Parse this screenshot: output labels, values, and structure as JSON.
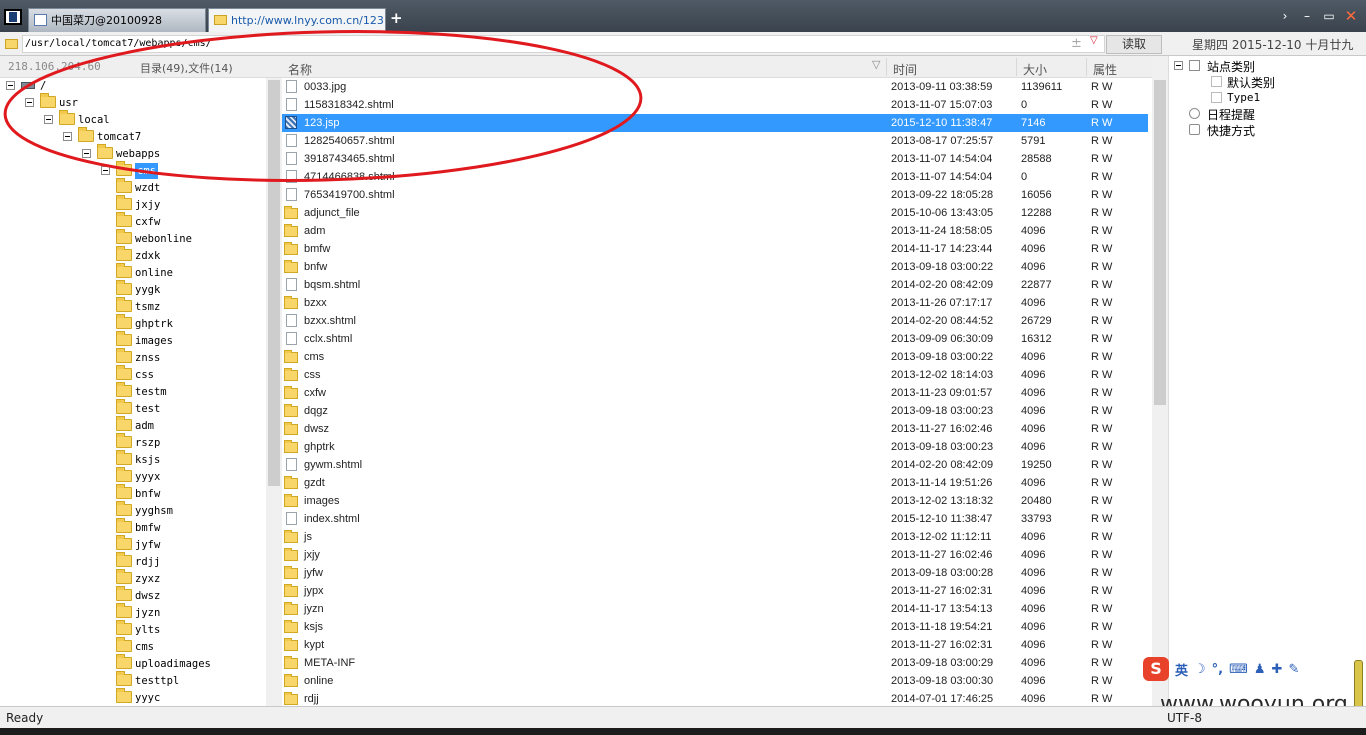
{
  "tabs": [
    {
      "label": "中国菜刀@20100928",
      "icon": "page-icon"
    },
    {
      "label": "http://www.lnyy.com.cn/123.j...",
      "icon": "folder-icon"
    }
  ],
  "tab_add_label": "+",
  "window_controls": {
    "more": "›",
    "minimize": "–",
    "maximize": "▭",
    "close": "✕"
  },
  "address": {
    "path": "/usr/local/tomcat7/webapps/cms/",
    "read_label": "读取",
    "add_glyph": "±",
    "dropdown_glyph": "▽",
    "date": "星期四 2015-12-10 十月廿九"
  },
  "left_panel": {
    "ip": "218.106.204.60",
    "count": "目录(49),文件(14)"
  },
  "tree": [
    {
      "label": "/",
      "icon": "drive-icon"
    },
    {
      "label": "usr",
      "icon": "folder-icon"
    },
    {
      "label": "local",
      "icon": "folder-icon"
    },
    {
      "label": "tomcat7",
      "icon": "folder-icon"
    },
    {
      "label": "webapps",
      "icon": "folder-icon"
    },
    {
      "label": "cms",
      "icon": "folder-icon",
      "selected": true
    },
    {
      "label": "wzdt",
      "icon": "folder-icon"
    },
    {
      "label": "jxjy",
      "icon": "folder-icon"
    },
    {
      "label": "cxfw",
      "icon": "folder-icon"
    },
    {
      "label": "webonline",
      "icon": "folder-icon"
    },
    {
      "label": "zdxk",
      "icon": "folder-icon"
    },
    {
      "label": "online",
      "icon": "folder-icon"
    },
    {
      "label": "yygk",
      "icon": "folder-icon"
    },
    {
      "label": "tsmz",
      "icon": "folder-icon"
    },
    {
      "label": "ghptrk",
      "icon": "folder-icon"
    },
    {
      "label": "images",
      "icon": "folder-icon"
    },
    {
      "label": "znss",
      "icon": "folder-icon"
    },
    {
      "label": "css",
      "icon": "folder-icon"
    },
    {
      "label": "testm",
      "icon": "folder-icon"
    },
    {
      "label": "test",
      "icon": "folder-icon"
    },
    {
      "label": "adm",
      "icon": "folder-icon"
    },
    {
      "label": "rszp",
      "icon": "folder-icon"
    },
    {
      "label": "ksjs",
      "icon": "folder-icon"
    },
    {
      "label": "yyyx",
      "icon": "folder-icon"
    },
    {
      "label": "bnfw",
      "icon": "folder-icon"
    },
    {
      "label": "yyghsm",
      "icon": "folder-icon"
    },
    {
      "label": "bmfw",
      "icon": "folder-icon"
    },
    {
      "label": "jyfw",
      "icon": "folder-icon"
    },
    {
      "label": "rdjj",
      "icon": "folder-icon"
    },
    {
      "label": "zyxz",
      "icon": "folder-icon"
    },
    {
      "label": "dwsz",
      "icon": "folder-icon"
    },
    {
      "label": "jyzn",
      "icon": "folder-icon"
    },
    {
      "label": "ylts",
      "icon": "folder-icon"
    },
    {
      "label": "cms",
      "icon": "folder-icon"
    },
    {
      "label": "uploadimages",
      "icon": "folder-icon"
    },
    {
      "label": "testtpl",
      "icon": "folder-icon"
    },
    {
      "label": "yyyc",
      "icon": "folder-icon"
    }
  ],
  "columns": {
    "name": "名称",
    "time": "时间",
    "size": "大小",
    "attr": "属性"
  },
  "files": [
    {
      "name": "0033.jpg",
      "time": "2013-09-11 03:38:59",
      "size": "1139611",
      "attr": "R W",
      "type": "file"
    },
    {
      "name": "1158318342.shtml",
      "time": "2013-11-07 15:07:03",
      "size": "0",
      "attr": "R W",
      "type": "file"
    },
    {
      "name": "123.jsp",
      "time": "2015-12-10 11:38:47",
      "size": "7146",
      "attr": "R W",
      "type": "jsp",
      "selected": true
    },
    {
      "name": "1282540657.shtml",
      "time": "2013-08-17 07:25:57",
      "size": "5791",
      "attr": "R W",
      "type": "file"
    },
    {
      "name": "3918743465.shtml",
      "time": "2013-11-07 14:54:04",
      "size": "28588",
      "attr": "R W",
      "type": "file"
    },
    {
      "name": "4714466838.shtml",
      "time": "2013-11-07 14:54:04",
      "size": "0",
      "attr": "R W",
      "type": "file"
    },
    {
      "name": "7653419700.shtml",
      "time": "2013-09-22 18:05:28",
      "size": "16056",
      "attr": "R W",
      "type": "file"
    },
    {
      "name": "adjunct_file",
      "time": "2015-10-06 13:43:05",
      "size": "12288",
      "attr": "R W",
      "type": "folder"
    },
    {
      "name": "adm",
      "time": "2013-11-24 18:58:05",
      "size": "4096",
      "attr": "R W",
      "type": "folder"
    },
    {
      "name": "bmfw",
      "time": "2014-11-17 14:23:44",
      "size": "4096",
      "attr": "R W",
      "type": "folder"
    },
    {
      "name": "bnfw",
      "time": "2013-09-18 03:00:22",
      "size": "4096",
      "attr": "R W",
      "type": "folder"
    },
    {
      "name": "bqsm.shtml",
      "time": "2014-02-20 08:42:09",
      "size": "22877",
      "attr": "R W",
      "type": "file"
    },
    {
      "name": "bzxx",
      "time": "2013-11-26 07:17:17",
      "size": "4096",
      "attr": "R W",
      "type": "folder"
    },
    {
      "name": "bzxx.shtml",
      "time": "2014-02-20 08:44:52",
      "size": "26729",
      "attr": "R W",
      "type": "file"
    },
    {
      "name": "cclx.shtml",
      "time": "2013-09-09 06:30:09",
      "size": "16312",
      "attr": "R W",
      "type": "file"
    },
    {
      "name": "cms",
      "time": "2013-09-18 03:00:22",
      "size": "4096",
      "attr": "R W",
      "type": "folder"
    },
    {
      "name": "css",
      "time": "2013-12-02 18:14:03",
      "size": "4096",
      "attr": "R W",
      "type": "folder"
    },
    {
      "name": "cxfw",
      "time": "2013-11-23 09:01:57",
      "size": "4096",
      "attr": "R W",
      "type": "folder"
    },
    {
      "name": "dqgz",
      "time": "2013-09-18 03:00:23",
      "size": "4096",
      "attr": "R W",
      "type": "folder"
    },
    {
      "name": "dwsz",
      "time": "2013-11-27 16:02:46",
      "size": "4096",
      "attr": "R W",
      "type": "folder"
    },
    {
      "name": "ghptrk",
      "time": "2013-09-18 03:00:23",
      "size": "4096",
      "attr": "R W",
      "type": "folder"
    },
    {
      "name": "gywm.shtml",
      "time": "2014-02-20 08:42:09",
      "size": "19250",
      "attr": "R W",
      "type": "file"
    },
    {
      "name": "gzdt",
      "time": "2013-11-14 19:51:26",
      "size": "4096",
      "attr": "R W",
      "type": "folder"
    },
    {
      "name": "images",
      "time": "2013-12-02 13:18:32",
      "size": "20480",
      "attr": "R W",
      "type": "folder"
    },
    {
      "name": "index.shtml",
      "time": "2015-12-10 11:38:47",
      "size": "33793",
      "attr": "R W",
      "type": "file"
    },
    {
      "name": "js",
      "time": "2013-12-02 11:12:11",
      "size": "4096",
      "attr": "R W",
      "type": "folder"
    },
    {
      "name": "jxjy",
      "time": "2013-11-27 16:02:46",
      "size": "4096",
      "attr": "R W",
      "type": "folder"
    },
    {
      "name": "jyfw",
      "time": "2013-09-18 03:00:28",
      "size": "4096",
      "attr": "R W",
      "type": "folder"
    },
    {
      "name": "jypx",
      "time": "2013-11-27 16:02:31",
      "size": "4096",
      "attr": "R W",
      "type": "folder"
    },
    {
      "name": "jyzn",
      "time": "2014-11-17 13:54:13",
      "size": "4096",
      "attr": "R W",
      "type": "folder"
    },
    {
      "name": "ksjs",
      "time": "2013-11-18 19:54:21",
      "size": "4096",
      "attr": "R W",
      "type": "folder"
    },
    {
      "name": "kypt",
      "time": "2013-11-27 16:02:31",
      "size": "4096",
      "attr": "R W",
      "type": "folder"
    },
    {
      "name": "META-INF",
      "time": "2013-09-18 03:00:29",
      "size": "4096",
      "attr": "R W",
      "type": "folder"
    },
    {
      "name": "online",
      "time": "2013-09-18 03:00:30",
      "size": "4096",
      "attr": "R W",
      "type": "folder"
    },
    {
      "name": "rdjj",
      "time": "2014-07-01 17:46:25",
      "size": "4096",
      "attr": "R W",
      "type": "folder"
    }
  ],
  "right_panel": {
    "site_category": "站点类别",
    "default_category": "默认类别",
    "type1": "Type1",
    "schedule": "日程提醒",
    "shortcut": "快捷方式"
  },
  "ime": {
    "s": "S",
    "lang": "英",
    "g1": "☽",
    "g2": "°,",
    "g3": "⌨",
    "g4": "♟",
    "g5": "✚",
    "g6": "✎"
  },
  "watermark": "www.wooyun.org",
  "status": {
    "text": "Ready",
    "encoding": "UTF-8"
  },
  "colors": {
    "selection": "#3399ff",
    "folder": "#f9d66a",
    "annotation": "#e0191e"
  }
}
